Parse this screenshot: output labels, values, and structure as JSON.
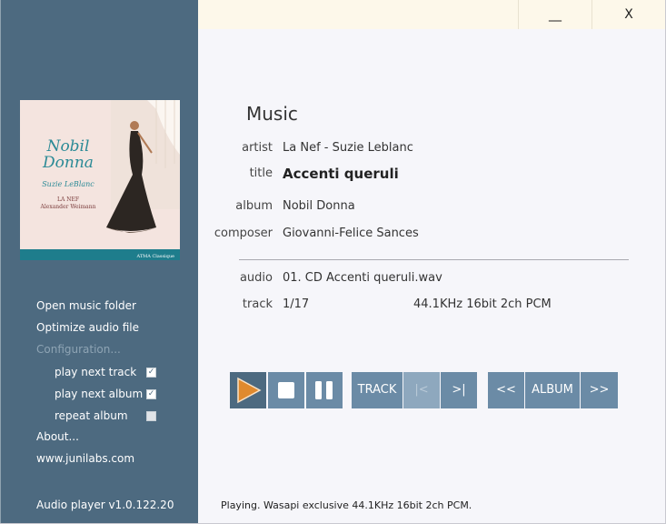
{
  "window": {
    "minimize_label": "__",
    "close_label": "X"
  },
  "cover": {
    "title": "Nobil Donna",
    "artist": "Suzie LeBlanc",
    "ensemble": "LA NEF",
    "director": "Alexander Weimann",
    "label": "ATMA Classique"
  },
  "sidebar": {
    "open_folder": "Open music folder",
    "optimize": "Optimize audio file",
    "configuration": "Configuration...",
    "options": [
      {
        "label": "play next track",
        "checked": true
      },
      {
        "label": "play next album",
        "checked": true
      },
      {
        "label": "repeat album",
        "checked": false
      }
    ],
    "about": "About...",
    "website": "www.junilabs.com",
    "version": "Audio player v1.0.122.20"
  },
  "info": {
    "heading": "Music",
    "artist_label": "artist",
    "artist": "La Nef - Suzie Leblanc",
    "title_label": "title",
    "title": "Accenti queruli",
    "album_label": "album",
    "album": "Nobil Donna",
    "composer_label": "composer",
    "composer": "Giovanni-Felice Sances",
    "audio_label": "audio",
    "audio": "01. CD Accenti queruli.wav",
    "track_label": "track",
    "track": "1/17",
    "format": "44.1KHz 16bit 2ch PCM"
  },
  "controls": {
    "track": "TRACK",
    "prev_track": "|<",
    "next_track": ">|",
    "prev_album": "<<",
    "album": "ALBUM",
    "next_album": ">>",
    "accent": "#e08a2e"
  },
  "status": "Playing. Wasapi exclusive 44.1KHz 16bit 2ch PCM."
}
